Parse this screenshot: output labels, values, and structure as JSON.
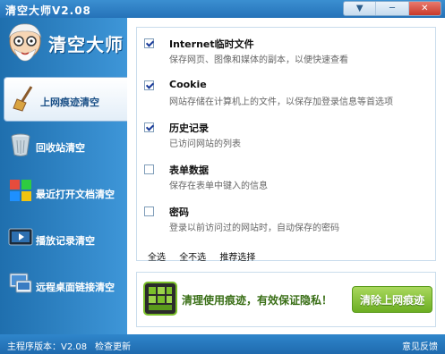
{
  "window": {
    "title": "清空大师V2.08",
    "buttons": [
      "▼",
      "─",
      "✕"
    ]
  },
  "sidebar": {
    "brand": "清空大师",
    "items": [
      {
        "label": "上网痕迹清空",
        "icon": "broom-icon",
        "active": true
      },
      {
        "label": "回收站清空",
        "icon": "recycle-bin-icon",
        "active": false
      },
      {
        "label": "最近打开文档清空",
        "icon": "windows-logo-icon",
        "active": false
      },
      {
        "label": "播放记录清空",
        "icon": "media-player-icon",
        "active": false
      },
      {
        "label": "远程桌面链接清空",
        "icon": "remote-desktop-icon",
        "active": false
      }
    ]
  },
  "options": [
    {
      "title": "Internet临时文件",
      "desc": "保存网页、图像和媒体的副本，以便快速查看",
      "checked": true
    },
    {
      "title": "Cookie",
      "desc": "网站存储在计算机上的文件，以保存加登录信息等首选项",
      "checked": true
    },
    {
      "title": "历史记录",
      "desc": "已访问网站的列表",
      "checked": true
    },
    {
      "title": "表单数据",
      "desc": "保存在表单中键入的信息",
      "checked": false
    },
    {
      "title": "密码",
      "desc": "登录以前访问过的网站时，自动保存的密码",
      "checked": false
    }
  ],
  "selection": {
    "all": "全选",
    "none": "全不选",
    "recommended": "推荐选择"
  },
  "bottom": {
    "slogan": "清理使用痕迹，有效保证隐私！",
    "clean_button": "清除上网痕迹"
  },
  "status": {
    "version": "主程序版本：V2.08",
    "update": "检查更新",
    "feedback": "意见反馈"
  },
  "colors": {
    "sidebar": "#2a7fc4",
    "accent_green": "#6cae22",
    "check": "#1b3c9a"
  }
}
